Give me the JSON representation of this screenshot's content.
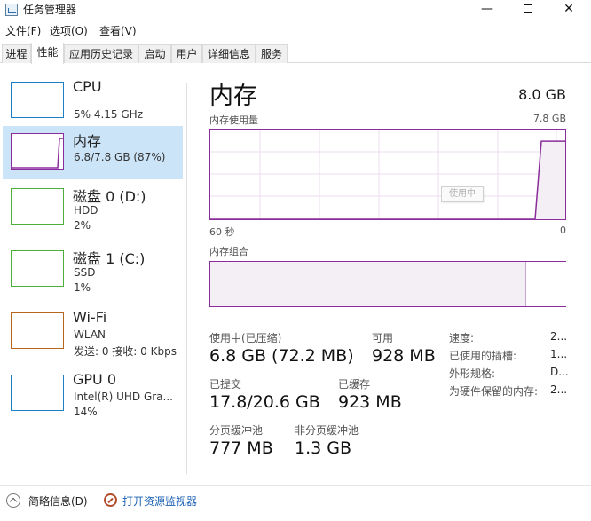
{
  "window": {
    "title": "任务管理器",
    "minimize": "—",
    "close": "✕"
  },
  "menu": [
    "文件(F)",
    "选项(O)",
    "查看(V)"
  ],
  "tabs": [
    "进程",
    "性能",
    "应用历史记录",
    "启动",
    "用户",
    "详细信息",
    "服务"
  ],
  "active_tab": "性能",
  "resources": [
    {
      "name": "CPU",
      "lines": [
        "5% 4.15 GHz"
      ],
      "color": "#1b7fc1"
    },
    {
      "name": "内存",
      "lines": [
        "6.8/7.8 GB (87%)"
      ],
      "color": "#8b2c9c"
    },
    {
      "name": "磁盘 0 (D:)",
      "lines": [
        "HDD",
        "2%"
      ],
      "color": "#4caf3a"
    },
    {
      "name": "磁盘 1 (C:)",
      "lines": [
        "SSD",
        "1%"
      ],
      "color": "#4caf3a"
    },
    {
      "name": "Wi-Fi",
      "lines": [
        "WLAN",
        "发送: 0 接收: 0 Kbps"
      ],
      "color": "#b6651d"
    },
    {
      "name": "GPU 0",
      "lines": [
        "Intel(R) UHD Gra...",
        "14%"
      ],
      "color": "#1b7fc1"
    }
  ],
  "selected_resource": "内存",
  "detail": {
    "title": "内存",
    "total": "8.0 GB",
    "usage_label": "内存使用量",
    "usage_max": "7.8 GB",
    "time_left": "60 秒",
    "time_right": "0",
    "tooltip": "使用中",
    "composition_label": "内存组合",
    "usage_fraction": 0.87,
    "stats": {
      "in_use_label": "使用中(已压缩)",
      "in_use_value": "6.8 GB (72.2 MB)",
      "available_label": "可用",
      "available_value": "928 MB",
      "committed_label": "已提交",
      "committed_value": "17.8/20.6 GB",
      "cached_label": "已缓存",
      "cached_value": "923 MB",
      "paged_label": "分页缓冲池",
      "paged_value": "777 MB",
      "nonpaged_label": "非分页缓冲池",
      "nonpaged_value": "1.3 GB"
    },
    "specs": [
      {
        "label": "速度:",
        "value": "2..."
      },
      {
        "label": "已使用的插槽:",
        "value": "1..."
      },
      {
        "label": "外形规格:",
        "value": "D..."
      },
      {
        "label": "为硬件保留的内存:",
        "value": "2..."
      }
    ]
  },
  "footer": {
    "summary": "简略信息(D)",
    "resource_monitor": "打开资源监视器"
  }
}
